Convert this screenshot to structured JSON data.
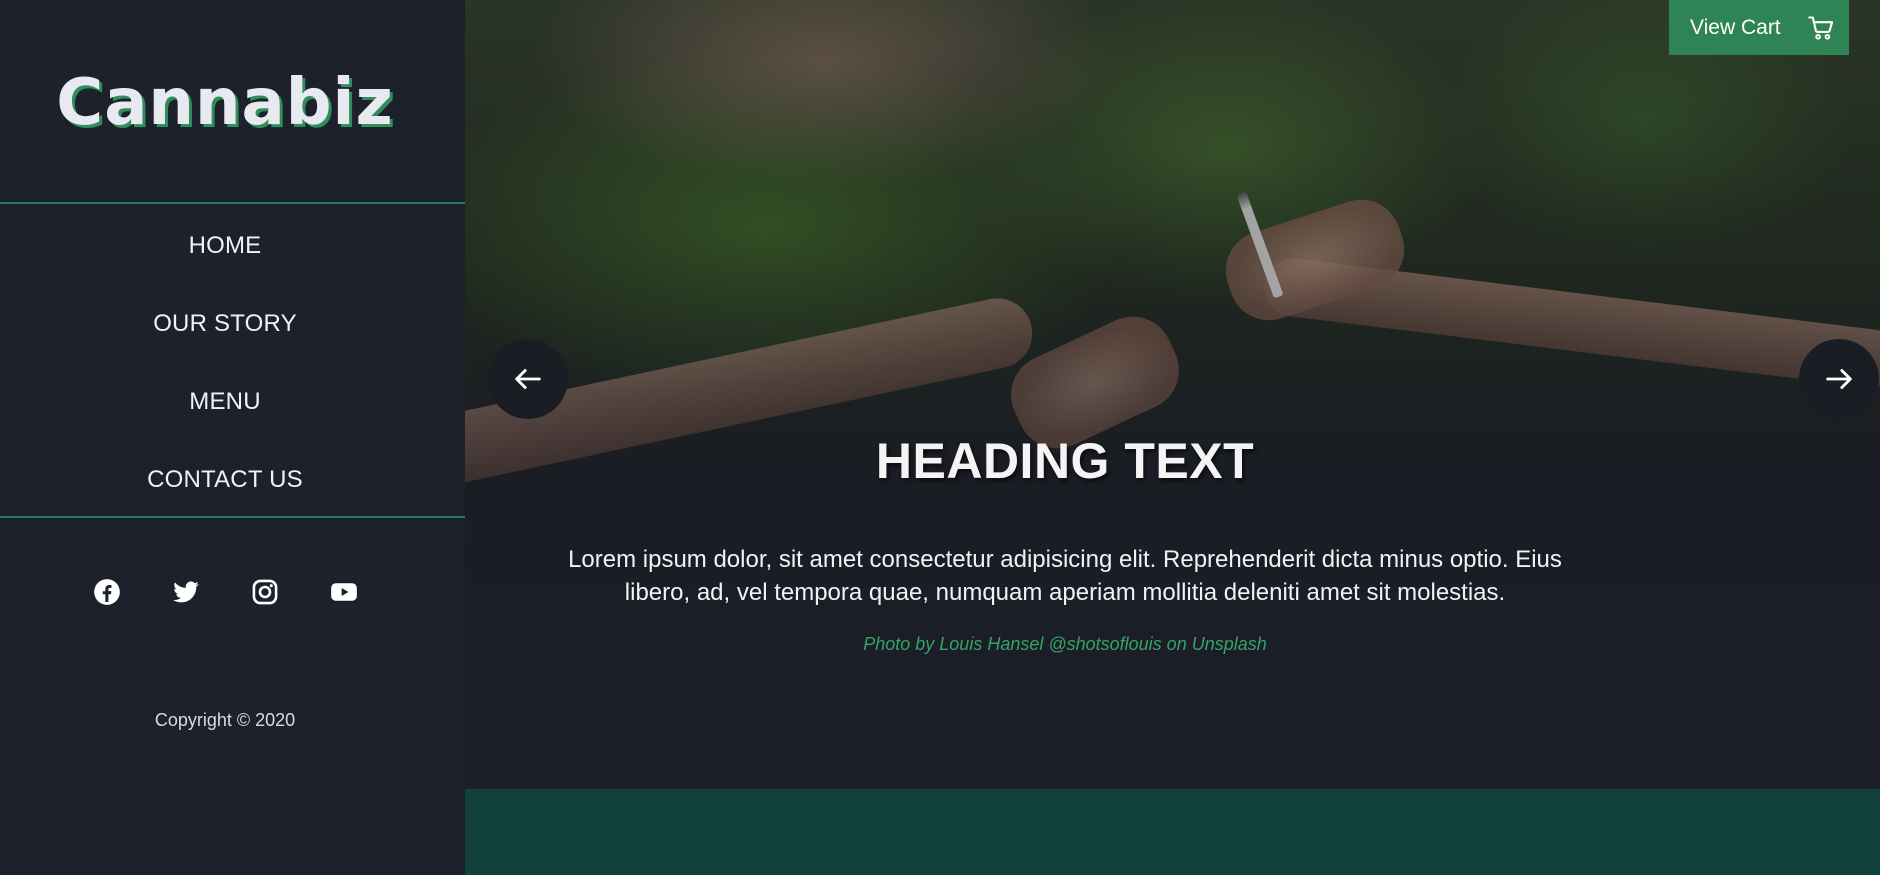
{
  "logo": {
    "text": "Cannabiz"
  },
  "nav": {
    "items": [
      {
        "label": "HOME"
      },
      {
        "label": "OUR STORY"
      },
      {
        "label": "MENU"
      },
      {
        "label": "CONTACT US"
      }
    ]
  },
  "social": {
    "icons": [
      "facebook-icon",
      "twitter-icon",
      "instagram-icon",
      "youtube-icon"
    ]
  },
  "footer": {
    "copyright": "Copyright © 2020"
  },
  "hero": {
    "heading": "HEADING TEXT",
    "text": "Lorem ipsum dolor, sit amet consectetur adipisicing elit. Reprehenderit dicta minus optio. Eius libero, ad, vel tempora quae, numquam aperiam mollitia deleniti amet sit molestias.",
    "credit": "Photo by Louis Hansel @shotsoflouis on Unsplash",
    "prev_icon": "arrow-left-icon",
    "next_icon": "arrow-right-icon"
  },
  "cart": {
    "label": "View Cart",
    "icon": "cart-icon"
  },
  "colors": {
    "sidebar_bg": "#1d212b",
    "accent_green": "#2f8456",
    "credit_green": "#35a367",
    "bottom_band": "#11403a"
  }
}
